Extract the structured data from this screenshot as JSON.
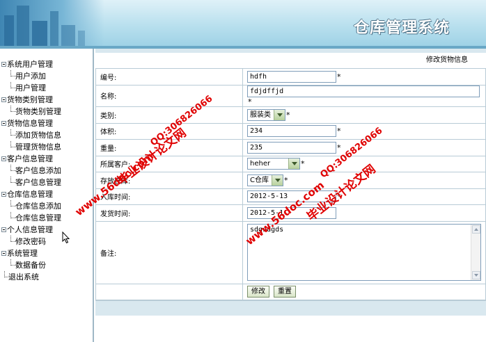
{
  "header": {
    "title": "仓库管理系统"
  },
  "sidebar": {
    "groups": [
      {
        "label": "系统用户管理",
        "children": [
          "用户添加",
          "用户管理"
        ]
      },
      {
        "label": "货物类别管理",
        "children": [
          "货物类别管理"
        ]
      },
      {
        "label": "货物信息管理",
        "children": [
          "添加货物信息",
          "管理货物信息"
        ]
      },
      {
        "label": "客户信息管理",
        "children": [
          "客户信息添加",
          "客户信息管理"
        ]
      },
      {
        "label": "仓库信息管理",
        "children": [
          "仓库信息添加",
          "仓库信息管理"
        ]
      },
      {
        "label": "个人信息管理",
        "children": [
          "修改密码"
        ]
      },
      {
        "label": "系统管理",
        "children": [
          "数据备份"
        ]
      }
    ],
    "logout": "退出系统"
  },
  "form": {
    "caption": "修改货物信息",
    "fields": {
      "code": {
        "label": "编号:",
        "value": "hdfh",
        "required": "*"
      },
      "name": {
        "label": "名称:",
        "value": "fdjdffjd",
        "required": "*"
      },
      "category": {
        "label": "类别:",
        "value": "服装类",
        "required": "*"
      },
      "volume": {
        "label": "体积:",
        "value": "234",
        "required": "*"
      },
      "weight": {
        "label": "重量:",
        "value": "235",
        "required": "*"
      },
      "customer": {
        "label": "所属客户:",
        "value": "heher",
        "required": "*"
      },
      "warehouse": {
        "label": "存放仓库:",
        "value": "C仓库",
        "required": "*"
      },
      "in_time": {
        "label": "入库时间:",
        "value": "2012-5-13",
        "required": "*"
      },
      "ship_time": {
        "label": "发货时间:",
        "value": "2012-5-1"
      },
      "remark": {
        "label": "备注:",
        "value": "sdgsdgds"
      }
    },
    "buttons": {
      "modify": "修改",
      "reset": "重置"
    }
  },
  "watermarks": {
    "site1": "www.56doc.com",
    "qq1": "QQ:306826066",
    "brand1": "毕业设计论文网",
    "site2": "www.56doc.com",
    "qq2": "QQ:306826066",
    "brand2": "毕业设计论文网"
  },
  "colors": {
    "watermark": "#e00000",
    "header_bg": "#b9e0ee",
    "border": "#b8cbd6"
  }
}
